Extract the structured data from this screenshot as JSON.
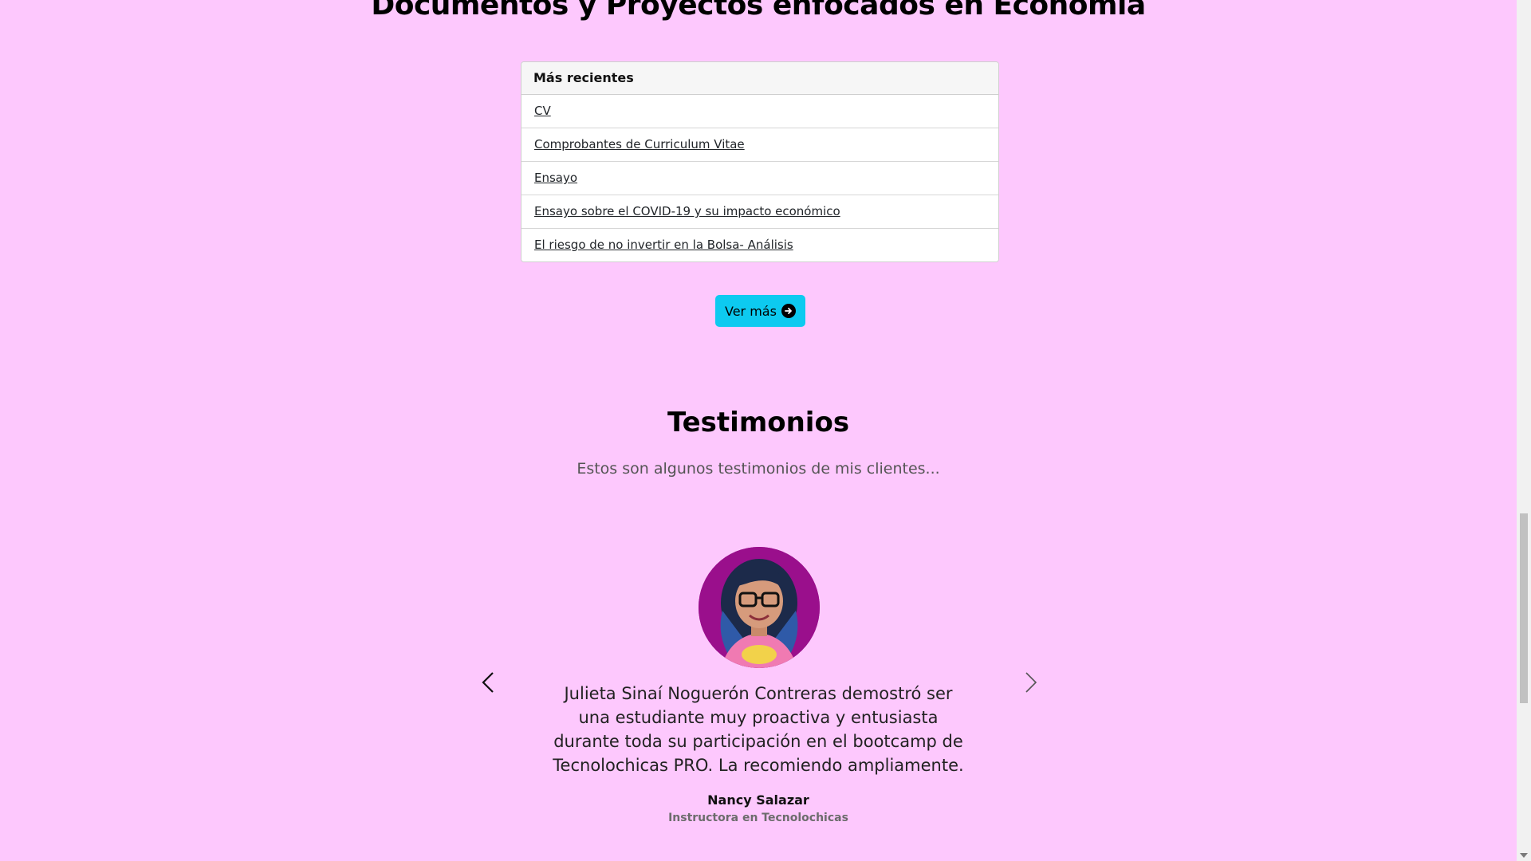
{
  "docs_section": {
    "title": "Documentos y Proyectos enfocados en Economía",
    "card_header": "Más recientes",
    "items": [
      {
        "label": "CV"
      },
      {
        "label": "Comprobantes de Curriculum Vitae"
      },
      {
        "label": "Ensayo"
      },
      {
        "label": "Ensayo sobre el COVID-19 y su impacto económico"
      },
      {
        "label": "El riesgo de no invertir en la Bolsa- Análisis"
      }
    ],
    "button_label": "Ver más",
    "button_icon": "arrow-right-circle-icon",
    "button_color": "#0dcaf0"
  },
  "testimonials": {
    "title": "Testimonios",
    "subtitle": "Estos son algunos testimonios de mis clientes...",
    "quote": "Julieta Sinaí Noguerón Contreras demostró ser una estudiante muy proactiva y entusiasta durante toda su participación en el bootcamp de Tecnolochicas PRO. La recomiendo ampliamente.",
    "author": "Nancy Salazar",
    "role": "Instructora en Tecnolochicas",
    "prev_icon": "chevron-left-icon",
    "next_icon": "chevron-right-icon"
  },
  "colors": {
    "background": "#fdc8fd",
    "accent": "#0dcaf0",
    "avatar_bg": "#9a0f8c"
  }
}
